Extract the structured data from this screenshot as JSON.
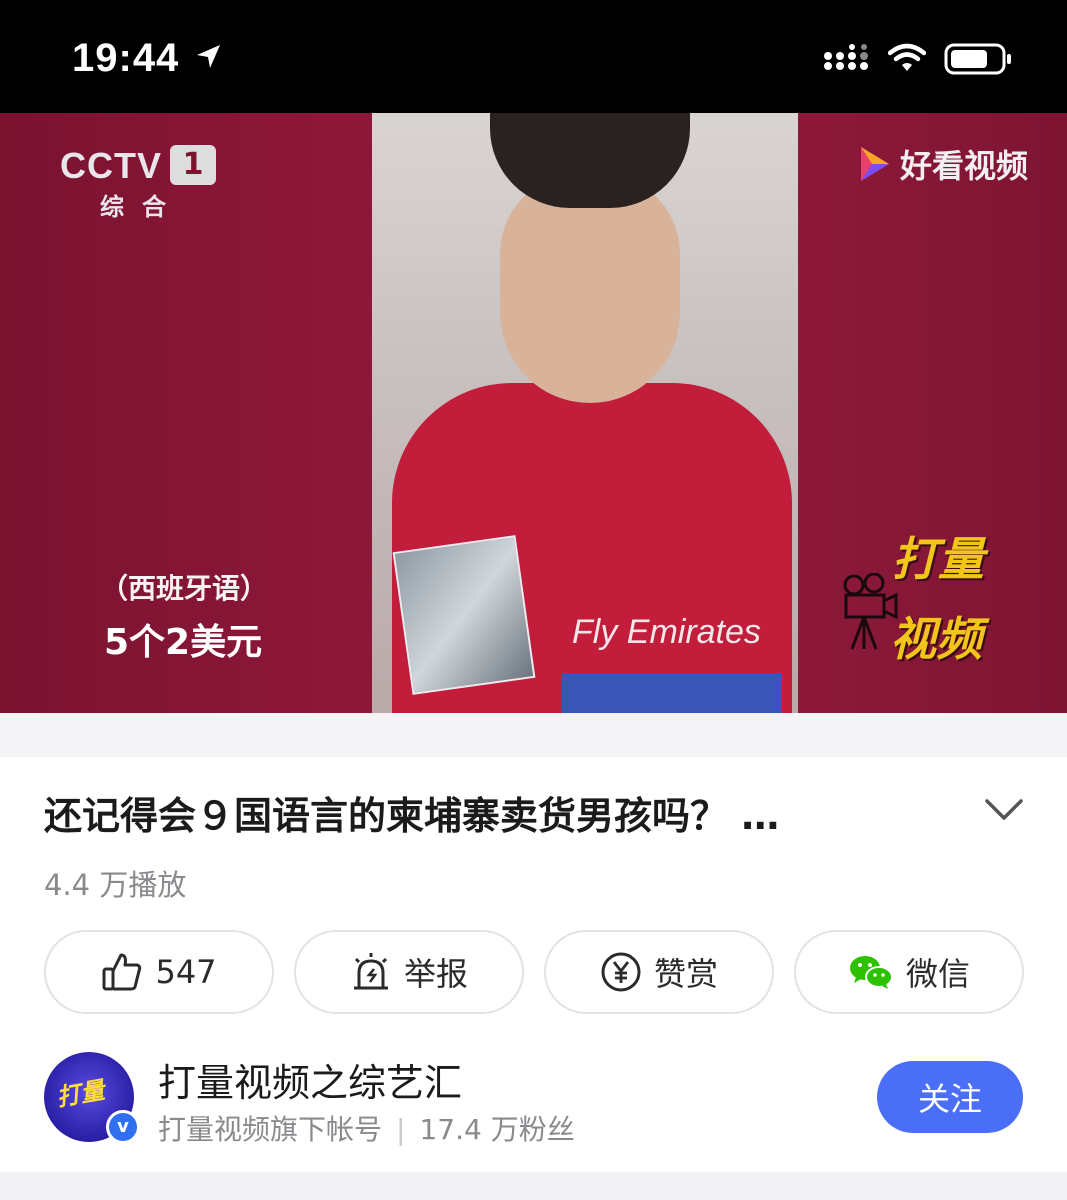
{
  "status_bar": {
    "time": "19:44"
  },
  "video": {
    "channel_logo": "CCTV",
    "channel_number": "1",
    "channel_sub": "综合",
    "watermark": "好看视频",
    "subtitle_language": "（西班牙语）",
    "subtitle_text": "5个2美元",
    "corner_logo": [
      "打量",
      "视频"
    ],
    "shirt_text": "Fly Emirates"
  },
  "title": "还记得会９国语言的柬埔寨卖货男孩吗？ …",
  "play_count": "4.4 万播放",
  "actions": [
    {
      "label": "547",
      "icon": "thumbs-up-icon"
    },
    {
      "label": "举报",
      "icon": "report-icon"
    },
    {
      "label": "赞赏",
      "icon": "yen-coin-icon"
    },
    {
      "label": "微信",
      "icon": "wechat-icon"
    }
  ],
  "author": {
    "name": "打量视频之综艺汇",
    "description": "打量视频旗下帐号",
    "followers": "17.4 万粉丝",
    "avatar_text": "打量",
    "verified_mark": "v",
    "follow_label": "关注"
  },
  "colors": {
    "accent": "#4a6ef5",
    "video_bg": "#8c1738"
  }
}
